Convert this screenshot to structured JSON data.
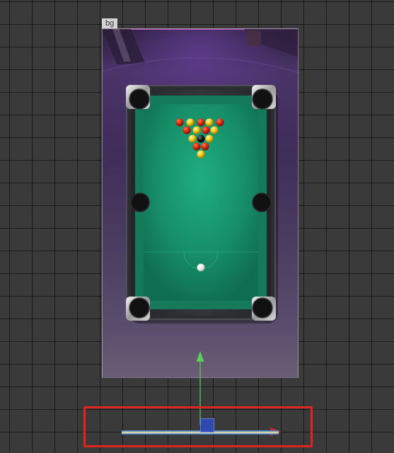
{
  "editor": {
    "node_label": "bg"
  },
  "colors": {
    "editor_background": "#3a3a3a",
    "felt_green": "#1a9a72",
    "rail_dark": "#2b2d30",
    "red_ball": "#d42a10",
    "yellow_ball": "#f0c816",
    "cue_ball": "#f5f5f0",
    "selection_highlight": "#e0251e",
    "gizmo_x_axis": "#e02020",
    "gizmo_y_axis": "#5ad05a",
    "gizmo_handle": "#2d4ab8"
  },
  "scene": {
    "ball_rack": {
      "rows": [
        [
          "red",
          "yellow",
          "red",
          "yellow",
          "red"
        ],
        [
          "red",
          "yellow",
          "red",
          "yellow"
        ],
        [
          "yellow",
          "black",
          "yellow"
        ],
        [
          "red",
          "red"
        ],
        [
          "yellow"
        ]
      ]
    },
    "pockets": [
      "top-left",
      "top-right",
      "middle-left",
      "middle-right",
      "bottom-left",
      "bottom-right"
    ]
  },
  "gizmo": {
    "icons": [
      "x-axis-arrow-icon",
      "y-axis-arrow-icon",
      "move-handle-icon"
    ]
  }
}
